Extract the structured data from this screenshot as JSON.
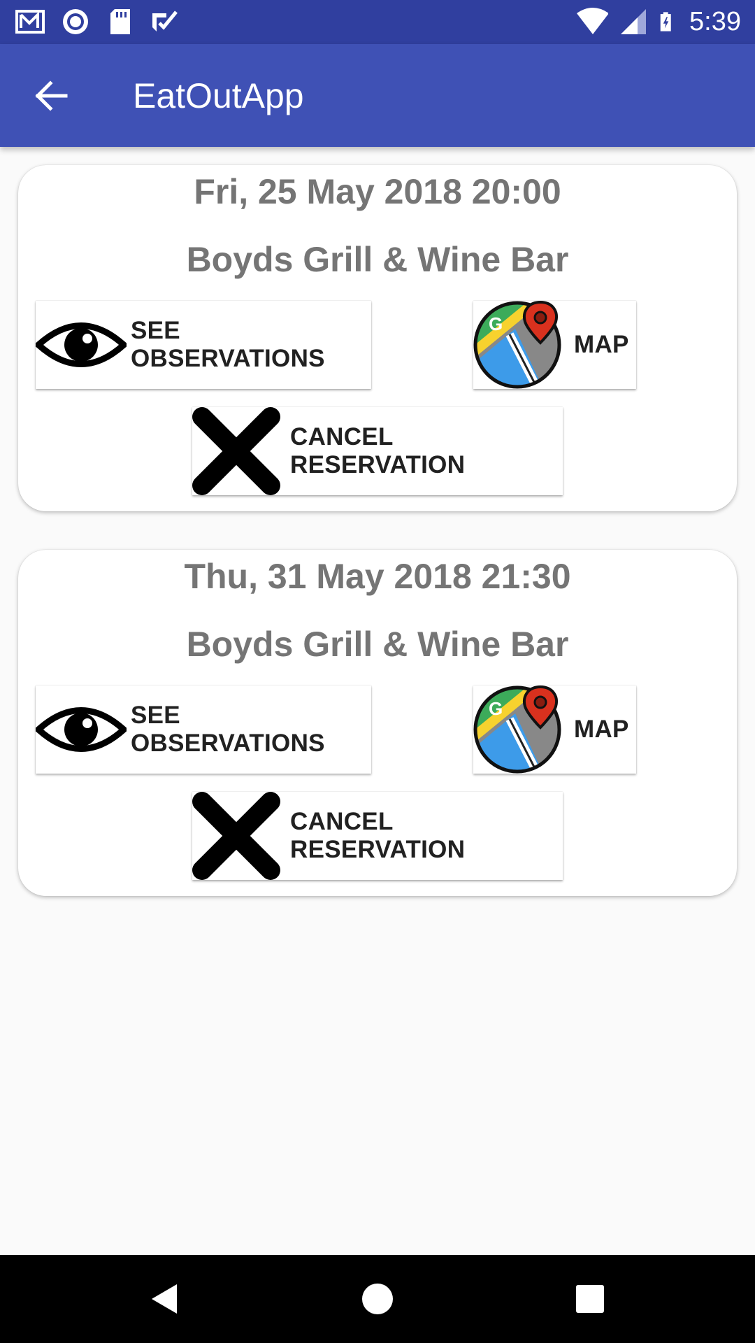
{
  "status_bar": {
    "time": "5:39",
    "icons_left": [
      "gmail-icon",
      "record-icon",
      "sd-card-icon",
      "task-icon"
    ],
    "icons_right": [
      "wifi-icon",
      "cell-signal-icon",
      "battery-charging-icon"
    ]
  },
  "app_bar": {
    "title": "EatOutApp",
    "back_icon": "arrow-back-icon"
  },
  "reservations": [
    {
      "datetime": "Fri, 25 May 2018 20:00",
      "restaurant": "Boyds Grill & Wine Bar",
      "see_observations_label": "SEE OBSERVATIONS",
      "map_label": "MAP",
      "cancel_label": "CANCEL RESERVATION"
    },
    {
      "datetime": "Thu, 31 May 2018 21:30",
      "restaurant": "Boyds Grill & Wine Bar",
      "see_observations_label": "SEE OBSERVATIONS",
      "map_label": "MAP",
      "cancel_label": "CANCEL RESERVATION"
    }
  ],
  "nav_bar": {
    "buttons": [
      "back-triangle-icon",
      "home-circle-icon",
      "recents-square-icon"
    ]
  },
  "colors": {
    "status_bar": "#303f9f",
    "app_bar": "#3f51b5",
    "background": "#fafafa",
    "card_text": "#757575"
  }
}
